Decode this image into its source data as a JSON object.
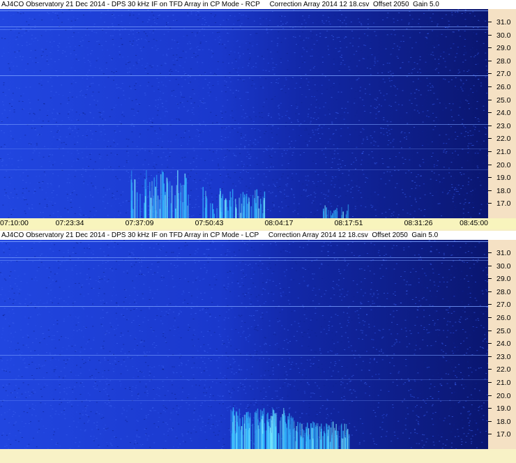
{
  "panels": [
    {
      "title": "AJ4CO Observatory 21 Dec 2014 - DPS 30 kHz IF on TFD Array in CP Mode - RCP     Correction Array 2014 12 18.csv  Offset 2050  Gain 5.0",
      "polarization": "RCP"
    },
    {
      "title": "AJ4CO Observatory 21 Dec 2014 - DPS 30 kHz IF on TFD Array in CP Mode - LCP     Correction Array 2014 12 18.csv  Offset 2050  Gain 5.0",
      "polarization": "LCP"
    }
  ],
  "y_ticks": [
    "31.0",
    "30.0",
    "29.0",
    "28.0",
    "27.0",
    "26.0",
    "25.0",
    "24.0",
    "23.0",
    "22.0",
    "21.0",
    "20.0",
    "19.0",
    "18.0",
    "17.0"
  ],
  "x_ticks": [
    "07:10:00",
    "07:23:34",
    "07:37:09",
    "07:50:43",
    "08:04:17",
    "08:17:51",
    "08:31:26",
    "08:45:00"
  ],
  "colors": {
    "spectrogram_base": "#1a3ad6",
    "spectrogram_dark": "#0a1a80",
    "burst": "#40d0ff",
    "y_axis_bg": "#f5e1c4",
    "x_axis_bg": "#f8f4bd"
  }
}
